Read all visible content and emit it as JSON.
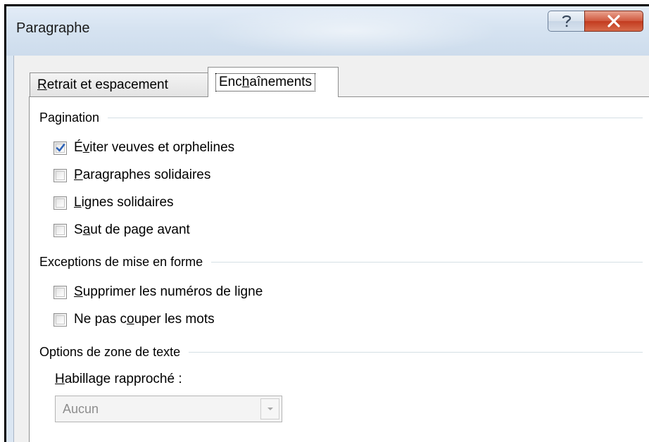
{
  "window": {
    "title": "Paragraphe",
    "help_button": "?",
    "close_button": "X"
  },
  "tabs": [
    {
      "label_pre": "",
      "mnemonic": "R",
      "label_post": "etrait et espacement",
      "active": false
    },
    {
      "label_pre": "Enc",
      "mnemonic": "h",
      "label_post": "aînements",
      "active": true
    }
  ],
  "pagination": {
    "title": "Pagination",
    "items": [
      {
        "pre": "É",
        "mnemonic": "v",
        "post": "iter veuves et orphelines",
        "checked": true
      },
      {
        "pre": "",
        "mnemonic": "P",
        "post": "aragraphes solidaires",
        "checked": false
      },
      {
        "pre": "",
        "mnemonic": "L",
        "post": "ignes solidaires",
        "checked": false
      },
      {
        "pre": "S",
        "mnemonic": "a",
        "post": "ut de page avant",
        "checked": false
      }
    ]
  },
  "exceptions": {
    "title": "Exceptions de mise en forme",
    "items": [
      {
        "pre": "",
        "mnemonic": "S",
        "post": "upprimer les numéros de ligne",
        "checked": false
      },
      {
        "pre": "Ne pas c",
        "mnemonic": "o",
        "post": "uper les mots",
        "checked": false
      }
    ]
  },
  "textbox_options": {
    "title": "Options de zone de texte",
    "wrap_label_mnemonic": "H",
    "wrap_label_rest": "abillage rapproché :",
    "wrap_value": "Aucun",
    "wrap_enabled": false
  },
  "colors": {
    "checkmark": "#2c62b8",
    "close_button": "#c23b1f",
    "disabled_text": "#8d8d8d"
  },
  "icons": {
    "help": "question-mark-icon",
    "close": "close-x-icon",
    "check": "checkmark-icon",
    "dropdown": "chevron-down-icon"
  }
}
